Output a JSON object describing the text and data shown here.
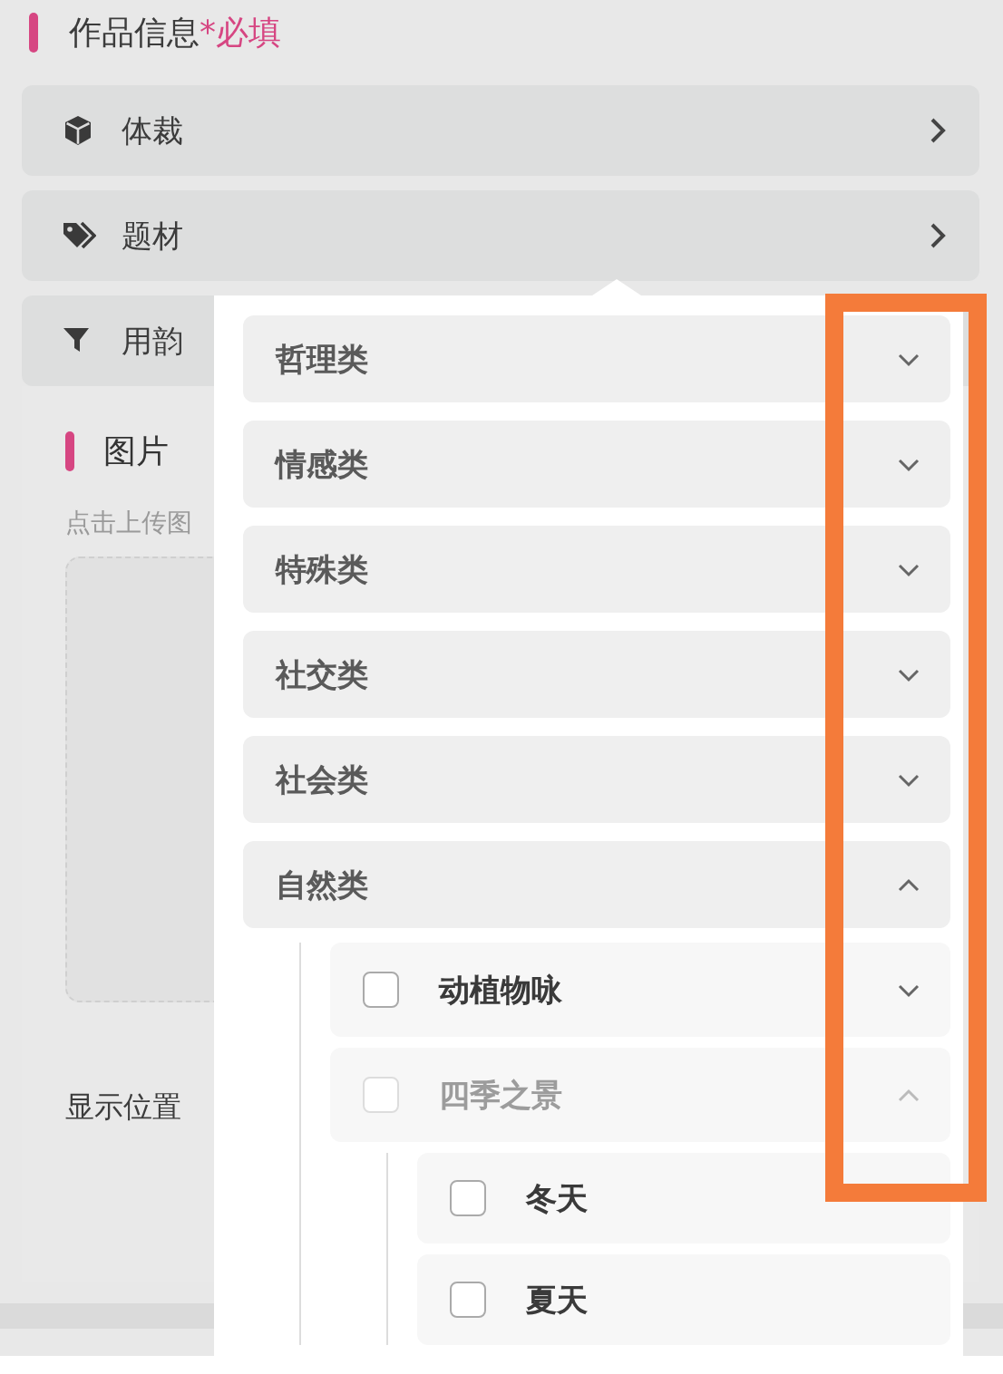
{
  "header": {
    "title": "作品信息",
    "required": "*必填"
  },
  "fields": [
    {
      "label": "体裁",
      "kind": "cube",
      "arrow": true
    },
    {
      "label": "题材",
      "kind": "tags",
      "arrow": true
    },
    {
      "label": "用韵",
      "kind": "filter",
      "arrow": false
    }
  ],
  "image_section": {
    "title": "图片",
    "hint": "点击上传图"
  },
  "position_label": "显示位置",
  "popover": {
    "categories": [
      {
        "label": "哲理类",
        "expanded": false
      },
      {
        "label": "情感类",
        "expanded": false
      },
      {
        "label": "特殊类",
        "expanded": false
      },
      {
        "label": "社交类",
        "expanded": false
      },
      {
        "label": "社会类",
        "expanded": false
      },
      {
        "label": "自然类",
        "expanded": true,
        "children": [
          {
            "label": "动植物咏",
            "checked": false,
            "disabled": false,
            "expanded": false
          },
          {
            "label": "四季之景",
            "checked": false,
            "disabled": true,
            "expanded": true,
            "children": [
              {
                "label": "冬天",
                "checked": false,
                "disabled": false
              },
              {
                "label": "夏天",
                "checked": false,
                "disabled": false
              }
            ]
          }
        ]
      }
    ]
  }
}
